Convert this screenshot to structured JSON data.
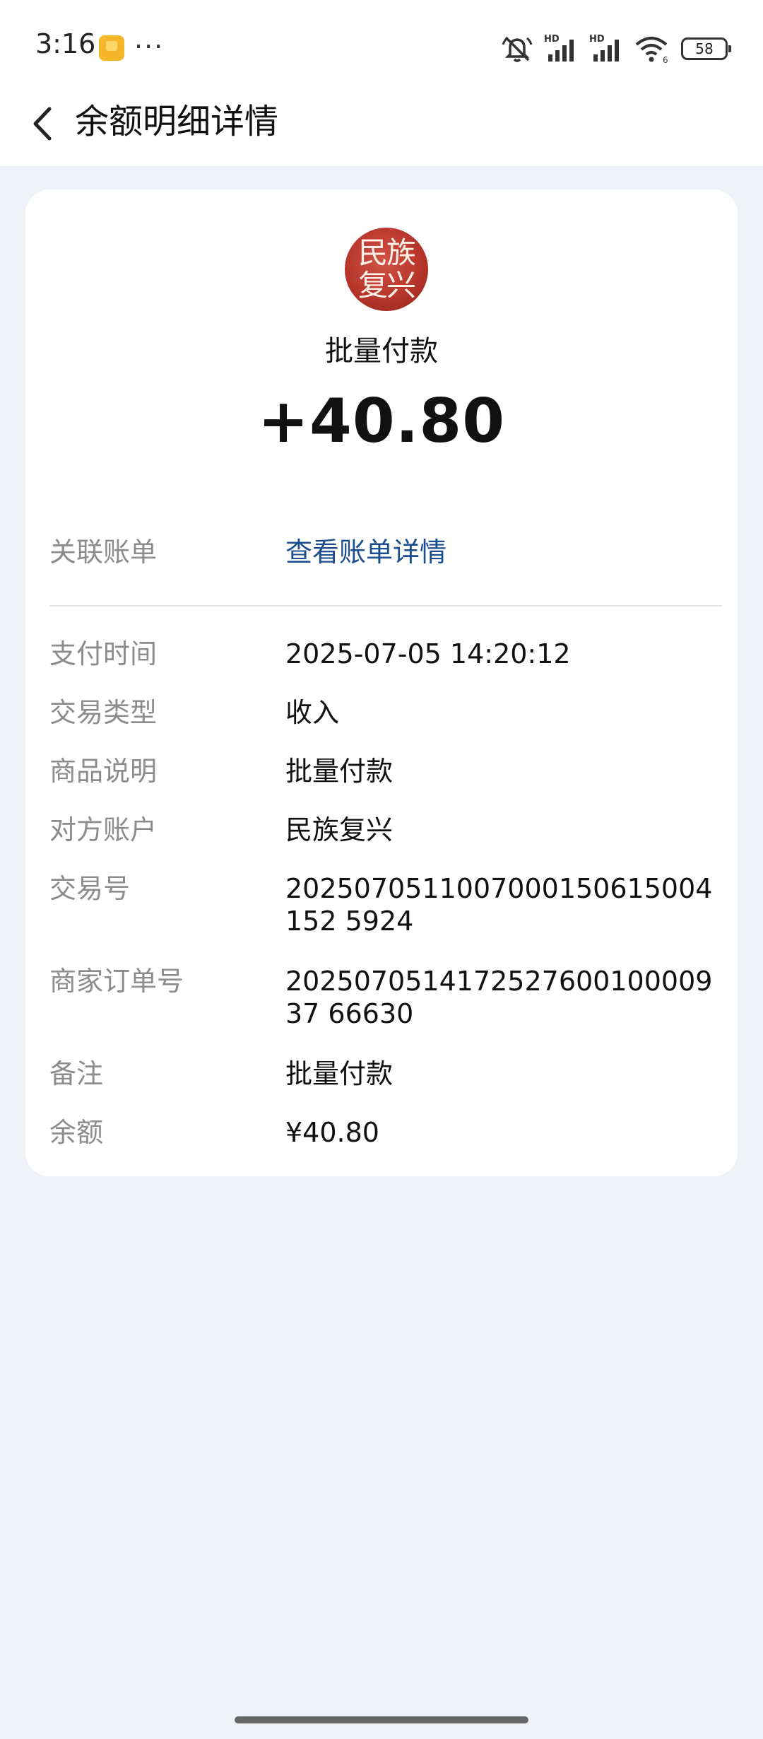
{
  "status_bar": {
    "time": "3:16",
    "battery": "58",
    "icons": [
      "notification-app-icon",
      "more-dots-icon",
      "mute-icon",
      "hd-signal-icon",
      "hd-signal-icon",
      "wifi-icon",
      "battery-icon"
    ],
    "dots": "···",
    "hd_label": "HD",
    "wifi_label": "6"
  },
  "header": {
    "title": "余额明细详情"
  },
  "transaction": {
    "avatar_text": "民族\n复兴",
    "merchant": "批量付款",
    "amount": "+40.80"
  },
  "linked_bill": {
    "label": "关联账单",
    "link_text": "查看账单详情"
  },
  "details": [
    {
      "label": "支付时间",
      "value": "2025-07-05 14:20:12"
    },
    {
      "label": "交易类型",
      "value": "收入"
    },
    {
      "label": "商品说明",
      "value": "批量付款"
    },
    {
      "label": "对方账户",
      "value": "民族复兴"
    },
    {
      "label": "交易号",
      "value": "2025070511007000150615004152 5924"
    },
    {
      "label": "商家订单号",
      "value": "202507051417252760010000937 66630"
    },
    {
      "label": "备注",
      "value": "批量付款"
    },
    {
      "label": "余额",
      "value": "¥40.80"
    }
  ],
  "colors": {
    "page_background": "#eff2f7",
    "link": "#1a4e8e",
    "label_gray": "#8c8c8c",
    "avatar_red": "#b8362b"
  }
}
